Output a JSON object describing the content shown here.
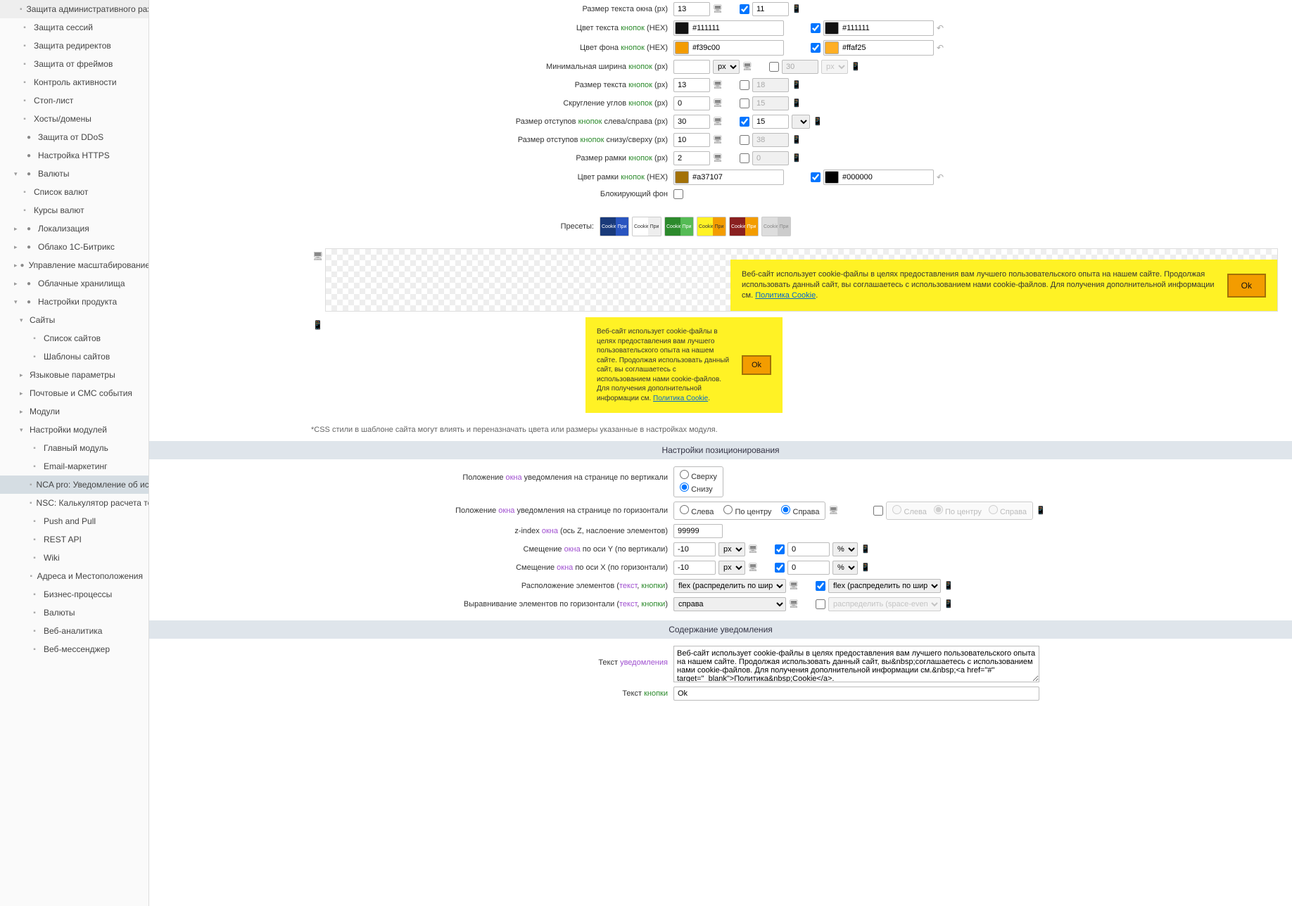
{
  "sidebar": {
    "items": [
      {
        "label": "Защита административного разде",
        "level": 1,
        "bullet": true
      },
      {
        "label": "Защита сессий",
        "level": 1,
        "bullet": true
      },
      {
        "label": "Защита редиректов",
        "level": 1,
        "bullet": true
      },
      {
        "label": "Защита от фреймов",
        "level": 1,
        "bullet": true
      },
      {
        "label": "Контроль активности",
        "level": 1,
        "bullet": true
      },
      {
        "label": "Стоп-лист",
        "level": 1,
        "bullet": true
      },
      {
        "label": "Хосты/домены",
        "level": 1,
        "bullet": true
      },
      {
        "label": "Защита от DDoS",
        "level": 0,
        "icon": "shield-red"
      },
      {
        "label": "Настройка HTTPS",
        "level": 0,
        "icon": "lock-blue"
      },
      {
        "label": "Валюты",
        "level": 0,
        "toggle": "down",
        "icon": "coin"
      },
      {
        "label": "Список валют",
        "level": 1,
        "bullet": true
      },
      {
        "label": "Курсы валют",
        "level": 1,
        "bullet": true
      },
      {
        "label": "Локализация",
        "level": 0,
        "toggle": "right",
        "icon": "globe"
      },
      {
        "label": "Облако 1С-Битрикс",
        "level": 0,
        "toggle": "right",
        "icon": "cloud"
      },
      {
        "label": "Управление масштабированием",
        "level": 0,
        "toggle": "right",
        "icon": "scale"
      },
      {
        "label": "Облачные хранилища",
        "level": 0,
        "toggle": "right",
        "icon": "storage"
      },
      {
        "label": "Настройки продукта",
        "level": 0,
        "toggle": "down",
        "icon": "gear"
      },
      {
        "label": "Сайты",
        "level": 1,
        "toggle": "down"
      },
      {
        "label": "Список сайтов",
        "level": 2,
        "bullet": true
      },
      {
        "label": "Шаблоны сайтов",
        "level": 2,
        "bullet": true
      },
      {
        "label": "Языковые параметры",
        "level": 1,
        "toggle": "right"
      },
      {
        "label": "Почтовые и СМС события",
        "level": 1,
        "toggle": "right"
      },
      {
        "label": "Модули",
        "level": 1,
        "toggle": "right"
      },
      {
        "label": "Настройки модулей",
        "level": 1,
        "toggle": "down"
      },
      {
        "label": "Главный модуль",
        "level": 2,
        "bullet": true
      },
      {
        "label": "Email-маркетинг",
        "level": 2,
        "bullet": true
      },
      {
        "label": "NCA pro: Уведомление об испо",
        "level": 2,
        "bullet": true,
        "active": true
      },
      {
        "label": "NSC: Калькулятор расчета тов",
        "level": 2,
        "bullet": true
      },
      {
        "label": "Push and Pull",
        "level": 2,
        "bullet": true
      },
      {
        "label": "REST API",
        "level": 2,
        "bullet": true
      },
      {
        "label": "Wiki",
        "level": 2,
        "bullet": true
      },
      {
        "label": "Адреса и Местоположения",
        "level": 2,
        "bullet": true
      },
      {
        "label": "Бизнес-процессы",
        "level": 2,
        "bullet": true
      },
      {
        "label": "Валюты",
        "level": 2,
        "bullet": true
      },
      {
        "label": "Веб-аналитика",
        "level": 2,
        "bullet": true
      },
      {
        "label": "Веб-мессенджер",
        "level": 2,
        "bullet": true
      }
    ]
  },
  "form": {
    "window_text_size": {
      "label": "Размер текста окна (px)",
      "v1": "13",
      "v2": "11",
      "chk": true
    },
    "btn_text_color": {
      "label_pre": "Цвет текста ",
      "label_hl": "кнопок",
      "label_post": " (HEX)",
      "v1": "#111111",
      "c1": "#111111",
      "v2": "#111111",
      "c2": "#111111",
      "chk": true
    },
    "btn_bg_color": {
      "label_pre": "Цвет фона ",
      "label_hl": "кнопок",
      "label_post": " (HEX)",
      "v1": "#f39c00",
      "c1": "#f39c00",
      "v2": "#ffaf25",
      "c2": "#ffaf25",
      "chk": true
    },
    "btn_min_width": {
      "label_pre": "Минимальная ширина ",
      "label_hl": "кнопок",
      "label_post": " (px)",
      "v1": "",
      "unit": "px",
      "v2": "30",
      "unit2": "px"
    },
    "btn_text_size": {
      "label_pre": "Размер текста ",
      "label_hl": "кнопок",
      "label_post": " (px)",
      "v1": "13",
      "v2": "18"
    },
    "btn_radius": {
      "label_pre": "Скругление углов ",
      "label_hl": "кнопок",
      "label_post": " (px)",
      "v1": "0",
      "v2": "15"
    },
    "btn_pad_h": {
      "label_pre": "Размер отступов ",
      "label_hl": "кнопок",
      "label_post": " слева/справа (px)",
      "v1": "30",
      "v2": "15",
      "chk": true
    },
    "btn_pad_v": {
      "label_pre": "Размер отступов ",
      "label_hl": "кнопок",
      "label_post": " снизу/сверху (px)",
      "v1": "10",
      "v2": "38"
    },
    "btn_border_w": {
      "label_pre": "Размер рамки ",
      "label_hl": "кнопок",
      "label_post": " (px)",
      "v1": "2",
      "v2": "0"
    },
    "btn_border_c": {
      "label_pre": "Цвет рамки ",
      "label_hl": "кнопок",
      "label_post": " (HEX)",
      "v1": "#a37107",
      "c1": "#a37107",
      "v2": "#000000",
      "c2": "#000000",
      "chk": true
    },
    "blocking_bg": {
      "label": "Блокирующий фон"
    },
    "presets_label": "Пресеты:",
    "preset_text": "Cookie",
    "preset_btn": "При"
  },
  "cookie_preview": {
    "text": "Веб-сайт использует cookie-файлы в целях предоставления вам лучшего пользовательского опыта на нашем сайте. Продолжая использовать данный сайт, вы соглашаетесь с использованием нами cookie-файлов. Для получения дополнительной информации см. ",
    "link": "Политика Cookie",
    "ok": "Ok"
  },
  "note": "*CSS стили в шаблоне сайта могут влиять и переназначать цвета или размеры указанные в настройках модуля.",
  "section_pos": "Настройки позиционирования",
  "pos": {
    "vert_label_pre": "Положение ",
    "vert_label_hl": "окна",
    "vert_label_post": " уведомления на странице по вертикали",
    "vert_opts": [
      "Сверху",
      "Снизу"
    ],
    "horiz_label_pre": "Положение ",
    "horiz_label_hl": "окна",
    "horiz_label_post": " уведомления на странице по горизонтали",
    "horiz_opts": [
      "Слева",
      "По центру",
      "Справа"
    ],
    "horiz_disabled_opts": [
      "Слева",
      "По центру",
      "Справа"
    ],
    "zindex_label_pre": "z-index ",
    "zindex_label_hl": "окна",
    "zindex_label_post": " (ось Z, наслоение элементов)",
    "zindex_val": "99999",
    "offy_label_pre": "Смещение ",
    "offy_label_hl": "окна",
    "offy_label_post": " по оси Y (по вертикали)",
    "offy_v1": "-10",
    "offy_u1": "px",
    "offy_v2": "0",
    "offy_u2": "%",
    "offx_label_pre": "Смещение ",
    "offx_label_hl": "окна",
    "offx_label_post": " по оси X (по горизонтали)",
    "offx_v1": "-10",
    "offx_u1": "px",
    "offx_v2": "0",
    "offx_u2": "%",
    "layout_label_pre": "Расположение элементов (",
    "layout_label_hl1": "текст",
    "layout_sep": ", ",
    "layout_label_hl2": "кнопки",
    "layout_label_post": ")",
    "layout_v1": "flex (распределить по ширине)",
    "layout_v2": "flex (распределить по ширине)",
    "align_label_pre": "Выравнивание элементов по горизонтали (",
    "align_v1": "справа",
    "align_v2": "распределить (space-evenly)"
  },
  "section_content": "Содержание уведомления",
  "content": {
    "text_label_pre": "Текст ",
    "text_label_hl": "уведомления",
    "text_val": "Веб-сайт использует cookie-файлы в целях предоставления вам лучшего пользовательского опыта на нашем сайте. Продолжая использовать данный сайт, вы&nbsp;соглашаетесь с использованием нами cookie-файлов. Для получения дополнительной информации см.&nbsp;<a href=\"#\" target=\"_blank\">Политика&nbsp;Cookie</a>.",
    "btn_label_pre": "Текст ",
    "btn_label_hl": "кнопки",
    "btn_val": "Ok"
  }
}
